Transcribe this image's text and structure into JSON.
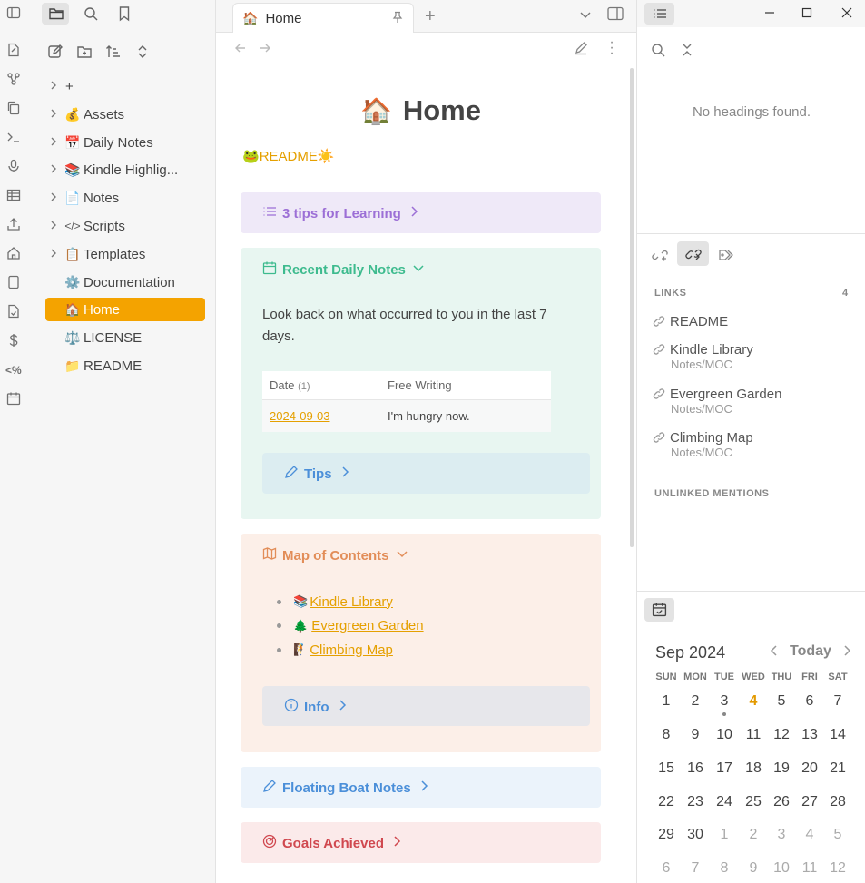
{
  "explorer": {
    "items": [
      {
        "label": "+",
        "icon": "",
        "chevron": true
      },
      {
        "label": "Assets",
        "icon": "💰",
        "chevron": true
      },
      {
        "label": "Daily Notes",
        "icon": "📅",
        "chevron": true
      },
      {
        "label": "Kindle Highlig...",
        "icon": "📚",
        "chevron": true
      },
      {
        "label": "Notes",
        "icon": "📄",
        "chevron": true
      },
      {
        "label": "Scripts",
        "icon": "</>",
        "chevron": true
      },
      {
        "label": "Templates",
        "icon": "📋",
        "chevron": true
      },
      {
        "label": "Documentation",
        "icon": "⚙️",
        "chevron": false
      },
      {
        "label": "Home",
        "icon": "🏠",
        "chevron": false,
        "active": true
      },
      {
        "label": "LICENSE",
        "icon": "⚖️",
        "chevron": false
      },
      {
        "label": "README",
        "icon": "📁",
        "chevron": false
      }
    ]
  },
  "tab": {
    "title": "Home",
    "icon": "🏠"
  },
  "doc": {
    "title": "Home",
    "title_icon": "🏠",
    "readme": {
      "prefix": "🐸",
      "label": "README",
      "suffix": "☀️"
    },
    "tips_learning": "3 tips for Learning",
    "recent": {
      "title": "Recent Daily Notes",
      "body": "Look back on what occurred to you in the last 7 days.",
      "col_date": "Date",
      "col_count": "(1)",
      "col_free": "Free Writing",
      "row_date": "2024-09-03",
      "row_text": "I'm hungry now.",
      "tips": "Tips"
    },
    "moc": {
      "title": "Map of Contents",
      "items": [
        {
          "icon": "📚",
          "label": "Kindle Library"
        },
        {
          "icon": "🌲",
          "label": "Evergreen Garden"
        },
        {
          "icon": "🧗",
          "label": "Climbing Map"
        }
      ],
      "info": "Info"
    },
    "floating": "Floating Boat Notes",
    "goals": "Goals Achieved"
  },
  "right": {
    "no_headings": "No headings found.",
    "links_label": "LINKS",
    "links_count": "4",
    "links": [
      {
        "name": "README",
        "path": ""
      },
      {
        "name": "Kindle Library",
        "path": "Notes/MOC"
      },
      {
        "name": "Evergreen Garden",
        "path": "Notes/MOC"
      },
      {
        "name": "Climbing Map",
        "path": "Notes/MOC"
      }
    ],
    "unlinked": "UNLINKED MENTIONS"
  },
  "calendar": {
    "month": "Sep",
    "year": "2024",
    "today_label": "Today",
    "dow": [
      "SUN",
      "MON",
      "TUE",
      "WED",
      "THU",
      "FRI",
      "SAT"
    ],
    "weeks": [
      [
        "1",
        "2",
        "3",
        "4",
        "5",
        "6",
        "7"
      ],
      [
        "8",
        "9",
        "10",
        "11",
        "12",
        "13",
        "14"
      ],
      [
        "15",
        "16",
        "17",
        "18",
        "19",
        "20",
        "21"
      ],
      [
        "22",
        "23",
        "24",
        "25",
        "26",
        "27",
        "28"
      ],
      [
        "29",
        "30",
        "1",
        "2",
        "3",
        "4",
        "5"
      ],
      [
        "6",
        "7",
        "8",
        "9",
        "10",
        "11",
        "12"
      ]
    ],
    "today_day": "4"
  },
  "colors": {
    "accent": "#f4a300",
    "link": "#e5a000"
  }
}
